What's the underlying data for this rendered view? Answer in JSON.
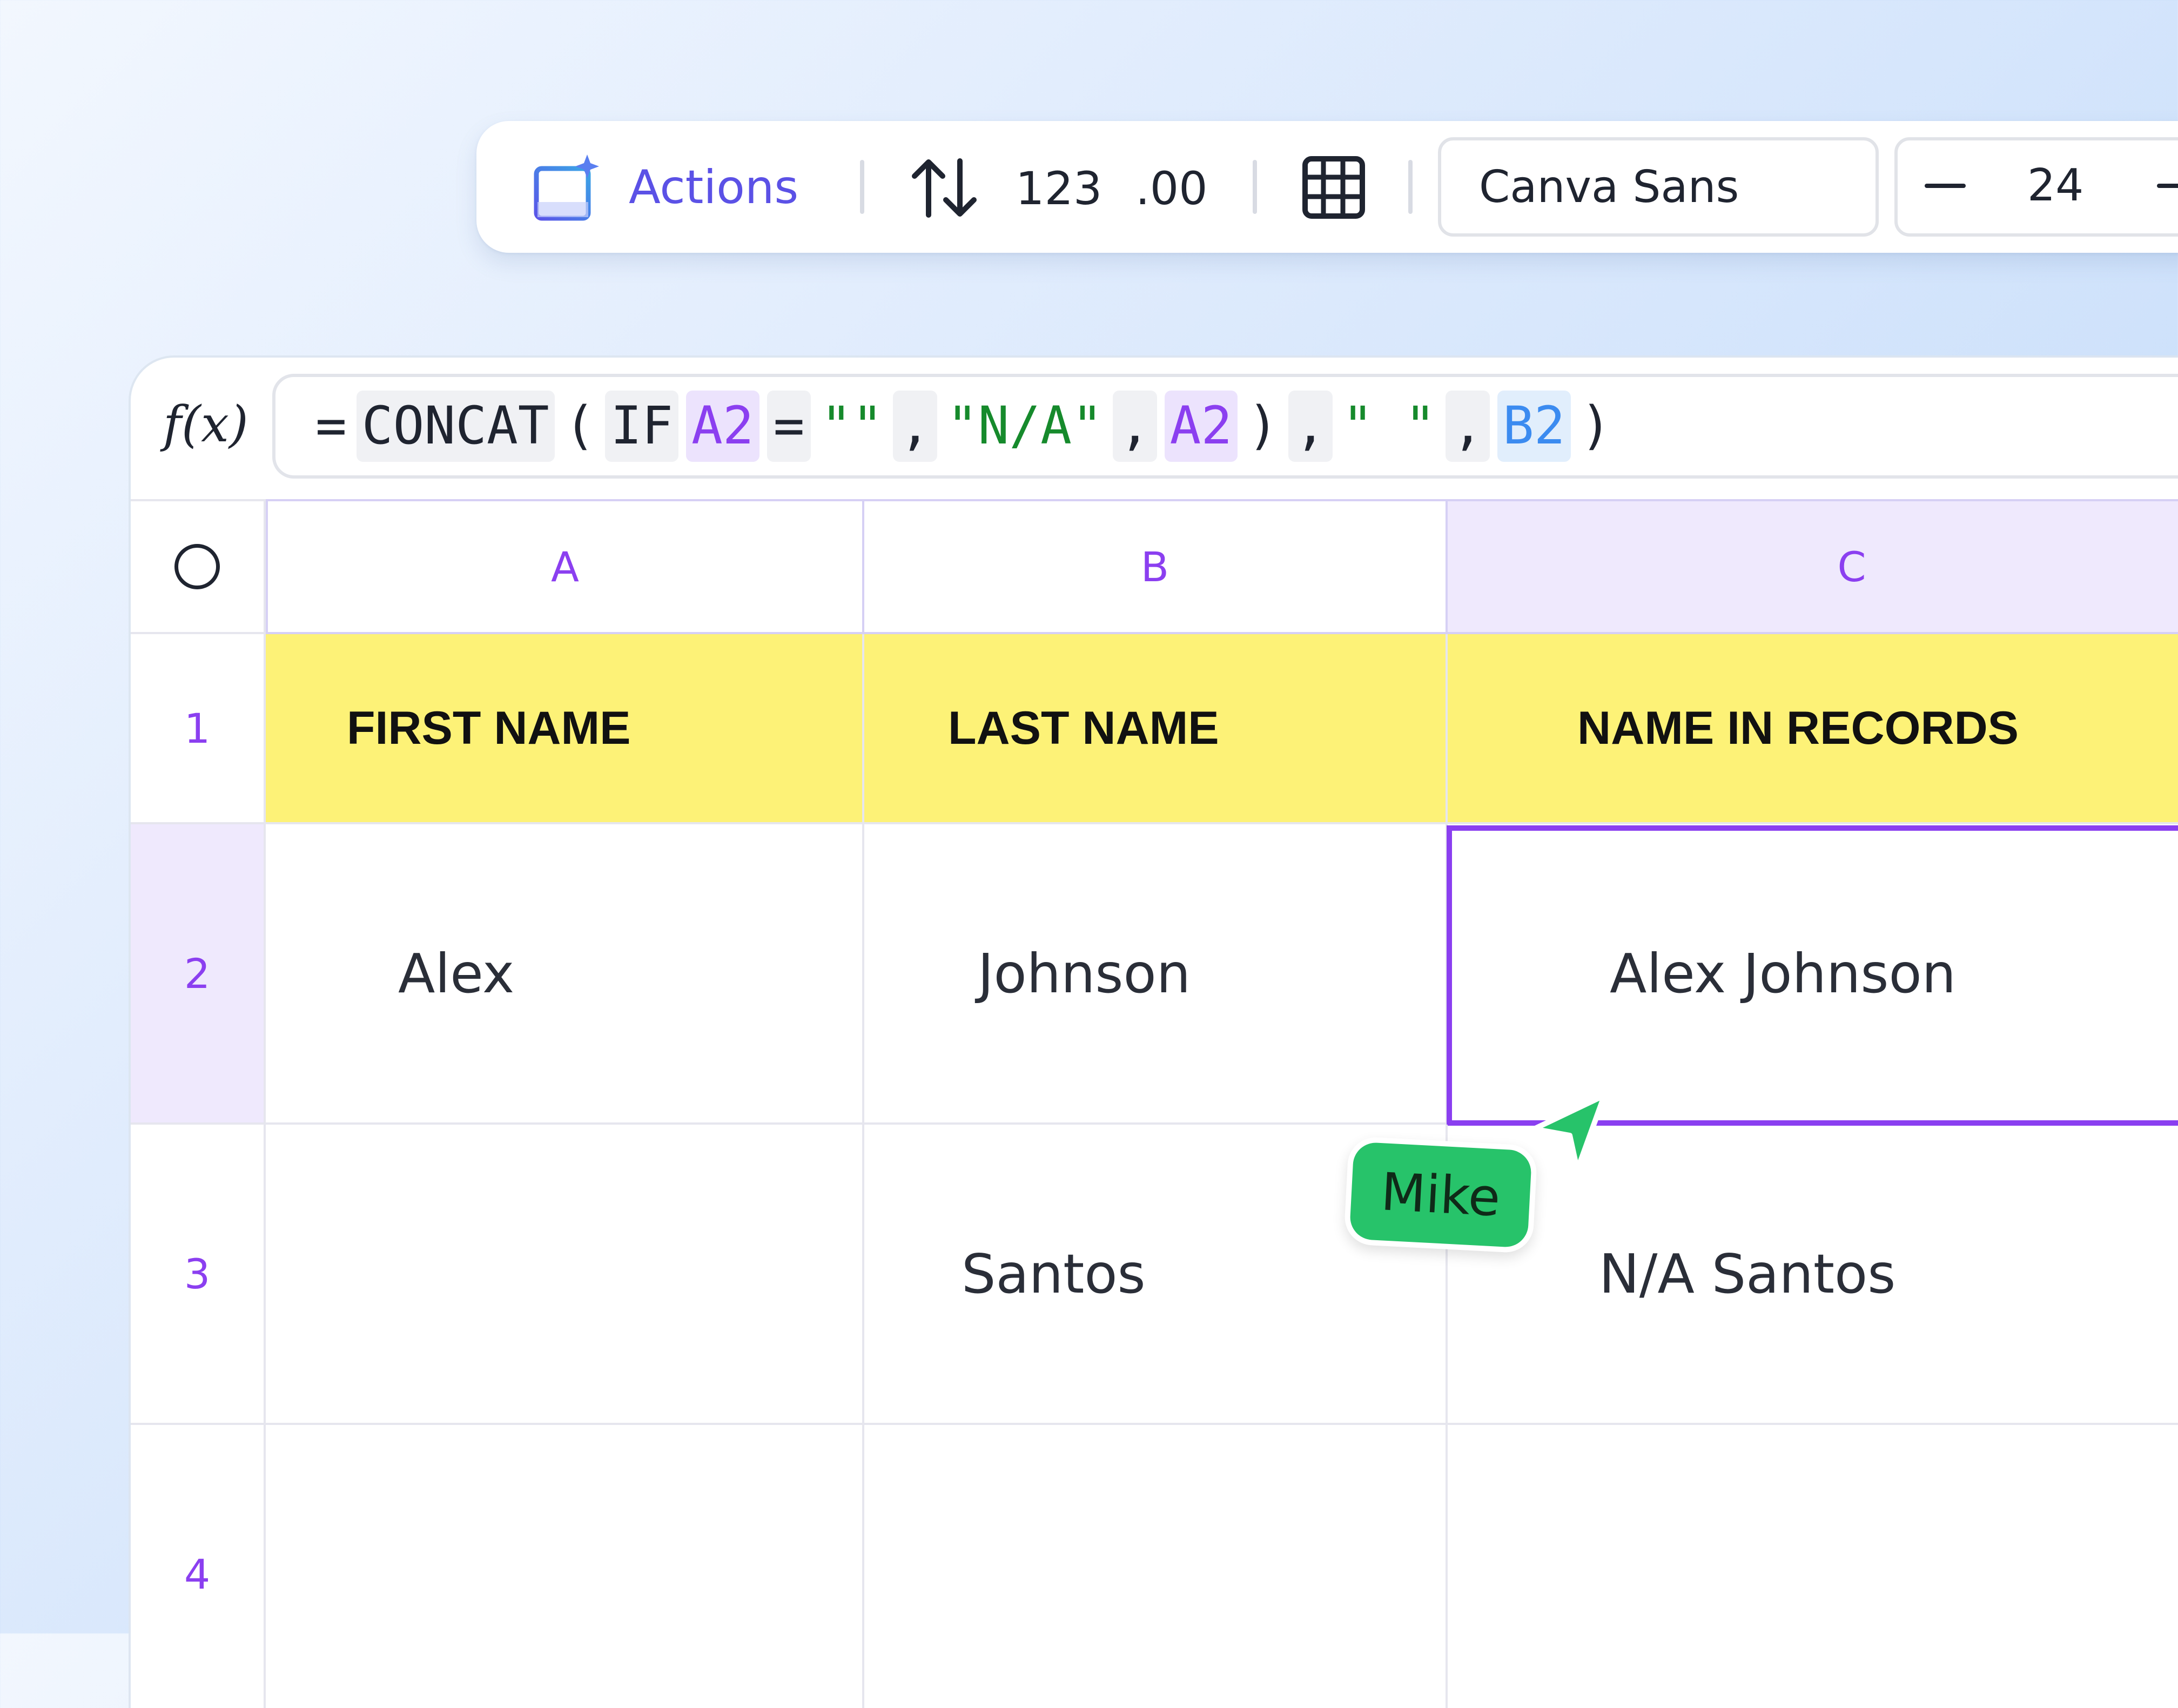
{
  "toolbar": {
    "actions_label": "Actions",
    "actions_icon": "table-sparkle-icon",
    "sort_icon": "sort-arrows-icon",
    "number_format_label": "123",
    "decimal_format_label": ".00",
    "borders_icon": "table-grid-icon",
    "font_name": "Canva Sans",
    "font_size": "24",
    "decrease_icon": "minus-icon",
    "increase_icon": "minus-icon"
  },
  "formula": {
    "fx_label": "f(x)",
    "tokens": {
      "eq": "=",
      "concat": "CONCAT",
      "open_paren": "(",
      "if_fn": "IF",
      "ref_a2": "A2",
      "eq2": "=",
      "empty_str": "\"\"",
      "comma1": ",",
      "na_str": "\"N/A\"",
      "comma2": ",",
      "ref_a2_2": "A2",
      "close_paren1": ")",
      "comma3": ",",
      "space_str": "\" \"",
      "comma4": ",",
      "ref_b2": "B2",
      "close_paren2": ")"
    }
  },
  "columns": [
    "A",
    "B",
    "C"
  ],
  "rows": [
    "1",
    "2",
    "3",
    "4"
  ],
  "header_row": [
    "FIRST NAME",
    "LAST NAME",
    "NAME IN RECORDS"
  ],
  "data": [
    [
      "Alex",
      "Johnson",
      "Alex Johnson"
    ],
    [
      "",
      "Santos",
      "N/A Santos"
    ],
    [
      "",
      "",
      ""
    ]
  ],
  "collaborator": {
    "name": "Mike",
    "color": "#27c36a"
  },
  "colors": {
    "accent": "#8a3ff0",
    "header_fill": "#fdf277",
    "active_header": "#efe9fd"
  }
}
